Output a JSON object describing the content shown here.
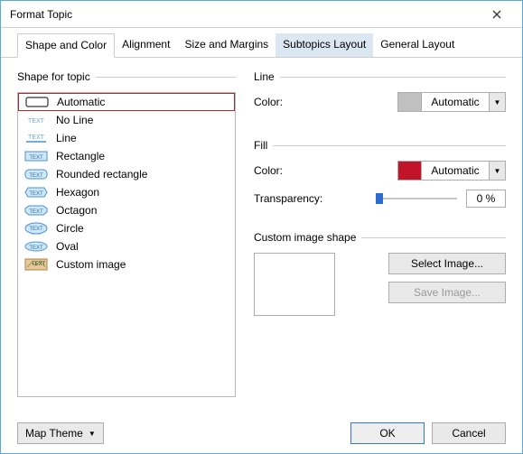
{
  "window": {
    "title": "Format Topic"
  },
  "tabs": [
    {
      "label": "Shape and Color",
      "active": true
    },
    {
      "label": "Alignment"
    },
    {
      "label": "Size and Margins"
    },
    {
      "label": "Subtopics Layout",
      "highlight": true
    },
    {
      "label": "General Layout"
    }
  ],
  "shapeGroup": {
    "title": "Shape for topic"
  },
  "shapes": [
    {
      "label": "Automatic",
      "selected": true
    },
    {
      "label": "No Line"
    },
    {
      "label": "Line"
    },
    {
      "label": "Rectangle"
    },
    {
      "label": "Rounded rectangle"
    },
    {
      "label": "Hexagon"
    },
    {
      "label": "Octagon"
    },
    {
      "label": "Circle"
    },
    {
      "label": "Oval"
    },
    {
      "label": "Custom image"
    }
  ],
  "lineGroup": {
    "title": "Line",
    "colorLabel": "Color:",
    "colorValue": "Automatic",
    "swatch": "#c0c0c0"
  },
  "fillGroup": {
    "title": "Fill",
    "colorLabel": "Color:",
    "colorValue": "Automatic",
    "swatch": "#c1132a",
    "transparencyLabel": "Transparency:",
    "transparencyValue": "0 %"
  },
  "customGroup": {
    "title": "Custom image shape",
    "selectBtn": "Select Image...",
    "saveBtn": "Save Image..."
  },
  "footer": {
    "theme": "Map Theme",
    "ok": "OK",
    "cancel": "Cancel"
  }
}
